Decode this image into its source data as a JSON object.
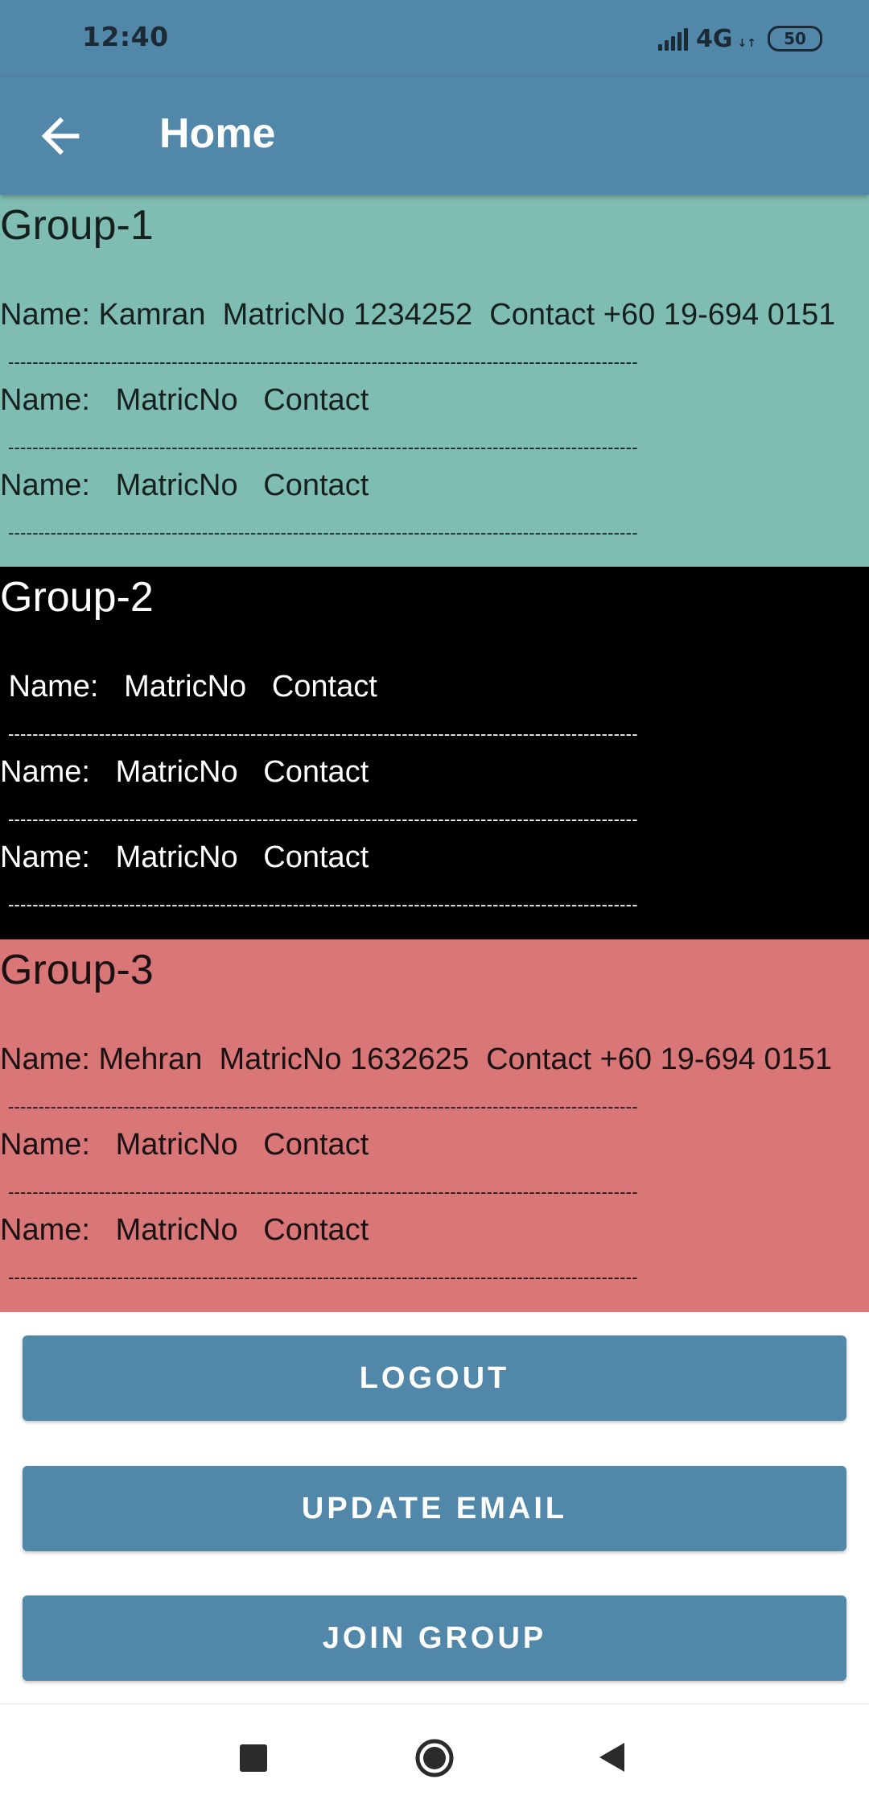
{
  "status_bar": {
    "time": "12:40",
    "network": "4G",
    "network_arrows": "↓↑",
    "battery": "50"
  },
  "app_bar": {
    "title": "Home",
    "back_icon": "arrow-left-icon"
  },
  "groups": [
    {
      "title": "Group-1",
      "background": "#7FBDB3",
      "members": [
        "Name: Kamran  MatricNo 1234252  Contact +60 19-694 0151",
        "Name:   MatricNo   Contact",
        "Name:   MatricNo   Contact"
      ]
    },
    {
      "title": "Group-2",
      "background": "#000000",
      "members": [
        " Name:   MatricNo   Contact",
        "Name:   MatricNo   Contact",
        "Name:   MatricNo   Contact"
      ]
    },
    {
      "title": "Group-3",
      "background": "#D87678",
      "members": [
        "Name: Mehran  MatricNo 1632625  Contact +60 19-694 0151",
        "Name:   MatricNo   Contact",
        "Name:   MatricNo   Contact"
      ]
    }
  ],
  "divider_text": "--------------------------------------------------------------------------------------------------------",
  "buttons": {
    "logout": "LOGOUT",
    "update_email": "UPDATE EMAIL",
    "join_group": "JOIN GROUP"
  },
  "nav_bar": {
    "recent_icon": "square-icon",
    "home_icon": "circle-icon",
    "back_icon": "triangle-back-icon"
  },
  "colors": {
    "primary": "#5187A8",
    "group1": "#7FBDB3",
    "group2": "#000000",
    "group3": "#D87678"
  }
}
